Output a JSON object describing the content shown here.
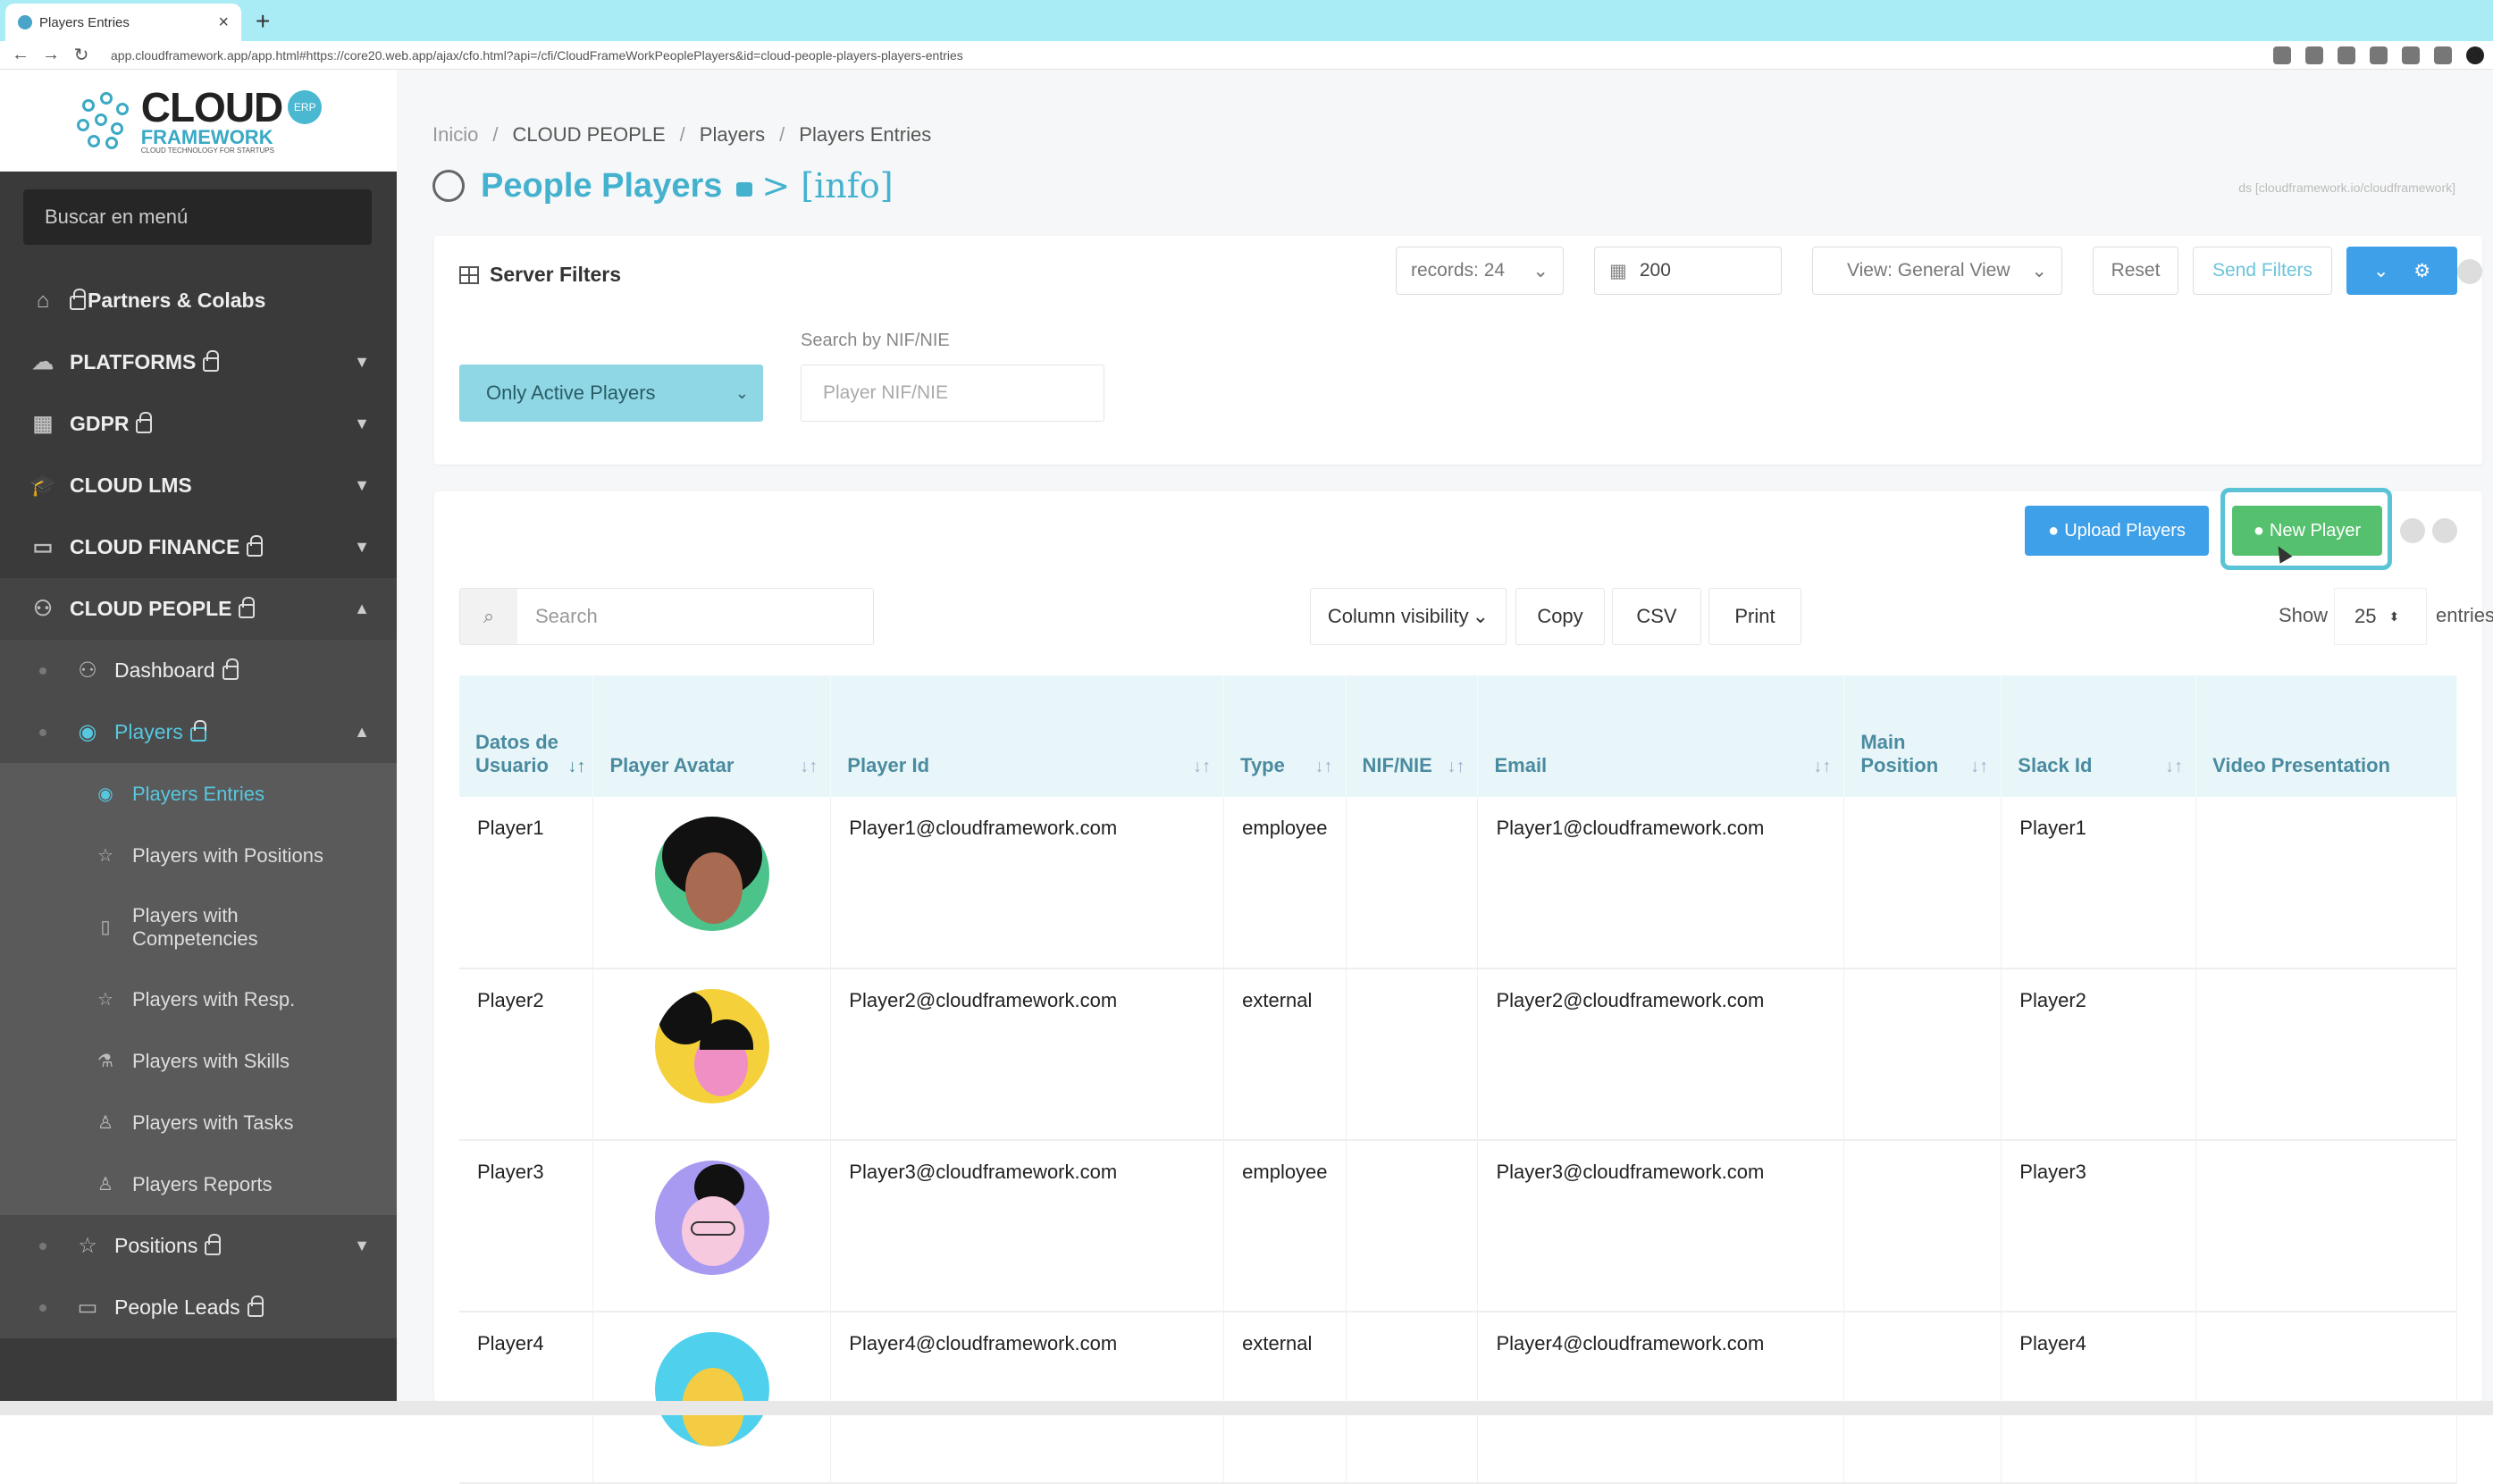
{
  "browser": {
    "tab_title": "Players Entries",
    "tab_close": "×",
    "new_tab": "+",
    "url": "app.cloudframework.app/app.html#https://core20.web.app/ajax/cfo.html?api=/cfi/CloudFrameWorkPeoplePlayers&id=cloud-people-players-players-entries"
  },
  "sidebar": {
    "logo_main": "CLOUD",
    "logo_sub": "FRAMEWORK",
    "logo_tag": "CLOUD TECHNOLOGY FOR STARTUPS",
    "logo_badge": "ERP",
    "search_placeholder": "Buscar en menú",
    "items": [
      {
        "label": "Partners & Colabs",
        "icon": "home-icon"
      },
      {
        "label": "PLATFORMS",
        "icon": "cloud-icon"
      },
      {
        "label": "GDPR",
        "icon": "building-icon"
      },
      {
        "label": "CLOUD LMS",
        "icon": "graduation-cap-icon"
      },
      {
        "label": "CLOUD FINANCE",
        "icon": "money-icon"
      },
      {
        "label": "CLOUD PEOPLE",
        "icon": "people-icon"
      }
    ],
    "people_sub": [
      {
        "label": "Dashboard"
      },
      {
        "label": "Players"
      }
    ],
    "players_sub": [
      {
        "label": "Players Entries"
      },
      {
        "label": "Players with Positions"
      },
      {
        "label": "Players with Competencies"
      },
      {
        "label": "Players with Resp."
      },
      {
        "label": "Players with Skills"
      },
      {
        "label": "Players with Tasks"
      },
      {
        "label": "Players Reports"
      }
    ],
    "people_sub_after": [
      {
        "label": "Positions"
      },
      {
        "label": "People Leads"
      }
    ]
  },
  "breadcrumb": [
    "Inicio",
    "CLOUD PEOPLE",
    "Players",
    "Players Entries"
  ],
  "breadcrumb_sep": "/",
  "page": {
    "title": "People Players",
    "title_suffix": "> [info]",
    "ds_text": "ds [cloudframework.io/cloudframework]"
  },
  "filters": {
    "title": "Server Filters",
    "records": "records: 24",
    "limit": "200",
    "view": "View: General View",
    "reset": "Reset",
    "send": "Send Filters",
    "active_filter": "Only Active Players",
    "nif_label": "Search by NIF/NIE",
    "nif_placeholder": "Player NIF/NIE"
  },
  "toolbar": {
    "upload": "Upload Players",
    "new_player": "New Player",
    "search_placeholder": "Search",
    "column_visibility": "Column visibility",
    "copy": "Copy",
    "csv": "CSV",
    "print": "Print",
    "show": "Show",
    "page_size": "25",
    "entries": "entries"
  },
  "table": {
    "headers": [
      "Datos de Usuario",
      "Player Avatar",
      "Player Id",
      "Type",
      "NIF/NIE",
      "Email",
      "Main Position",
      "Slack Id",
      "Video Presentation"
    ],
    "rows": [
      {
        "user": "Player1",
        "id": "Player1@cloudframework.com",
        "type": "employee",
        "nif": "",
        "email": "Player1@cloudframework.com",
        "position": "",
        "slack": "Player1",
        "video": ""
      },
      {
        "user": "Player2",
        "id": "Player2@cloudframework.com",
        "type": "external",
        "nif": "",
        "email": "Player2@cloudframework.com",
        "position": "",
        "slack": "Player2",
        "video": ""
      },
      {
        "user": "Player3",
        "id": "Player3@cloudframework.com",
        "type": "employee",
        "nif": "",
        "email": "Player3@cloudframework.com",
        "position": "",
        "slack": "Player3",
        "video": ""
      },
      {
        "user": "Player4",
        "id": "Player4@cloudframework.com",
        "type": "external",
        "nif": "",
        "email": "Player4@cloudframework.com",
        "position": "",
        "slack": "Player4",
        "video": ""
      }
    ]
  },
  "colors": {
    "accent": "#44b2cf",
    "sidebar_bg": "#3a3a3a",
    "primary_button": "#3ea0e8",
    "success_button": "#55c16e",
    "highlight": "#5bc3d6"
  }
}
